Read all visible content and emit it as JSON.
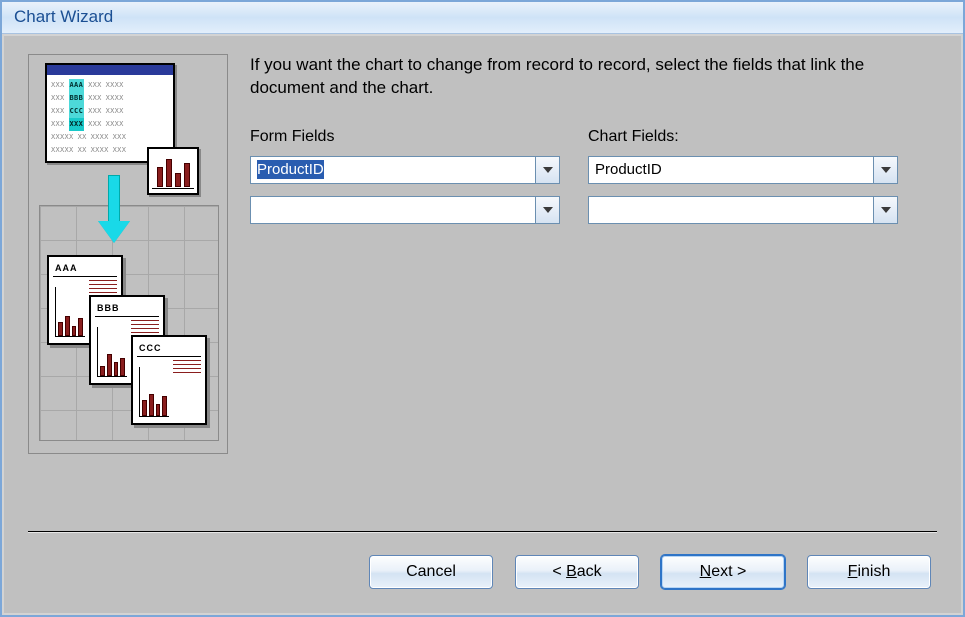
{
  "window": {
    "title": "Chart Wizard"
  },
  "instruction": "If you want the chart to change from record to record, select the fields that link the document and the chart.",
  "labels": {
    "form_fields": "Form Fields",
    "chart_fields": "Chart Fields:"
  },
  "fields": {
    "form_field_1": "ProductID",
    "form_field_2": "",
    "chart_field_1": "ProductID",
    "chart_field_2": ""
  },
  "buttons": {
    "cancel": "Cancel",
    "back": "Back",
    "next": "Next",
    "finish": "Finish",
    "back_prefix": "< ",
    "next_suffix": " >"
  },
  "preview": {
    "r1": "AAA",
    "r2": "BBB",
    "r3": "CCC",
    "report1": "AAA",
    "report2": "BBB",
    "report3": "CCC"
  }
}
